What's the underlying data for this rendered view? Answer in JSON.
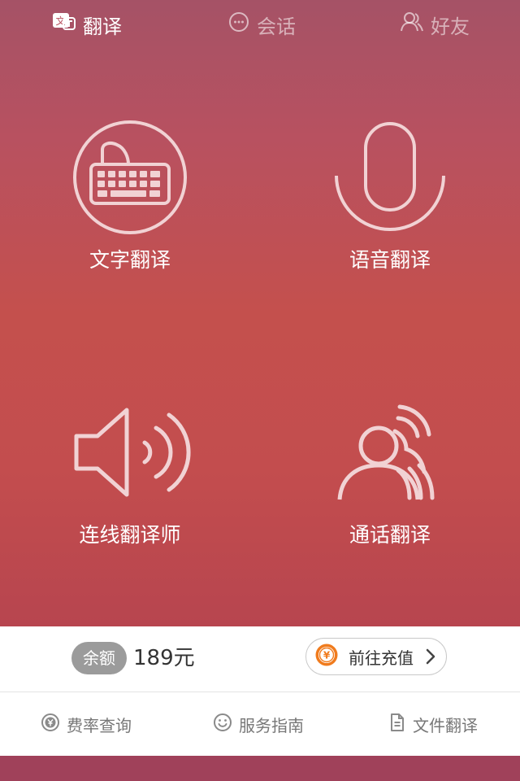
{
  "tabs": [
    {
      "label": "翻译",
      "icon": "translate-icon",
      "active": true
    },
    {
      "label": "会话",
      "icon": "chat-bubble-icon",
      "active": false
    },
    {
      "label": "好友",
      "icon": "friends-icon",
      "active": false
    }
  ],
  "features": {
    "text": {
      "label": "文字翻译",
      "icon": "keyboard-icon"
    },
    "voice": {
      "label": "语音翻译",
      "icon": "microphone-icon"
    },
    "line": {
      "label": "连线翻译师",
      "icon": "speaker-icon"
    },
    "call": {
      "label": "通话翻译",
      "icon": "call-people-icon"
    }
  },
  "balance": {
    "badge": "余额",
    "amount": "189元",
    "recharge_label": "前往充值",
    "coin_symbol": "¥"
  },
  "links": {
    "rate": "费率查询",
    "guide": "服务指南",
    "file": "文件翻译"
  },
  "colors": {
    "accent": "#c34d4e",
    "tab_active": "#ffffff",
    "footer": "#a0415a",
    "coin": "#f07b1d"
  }
}
